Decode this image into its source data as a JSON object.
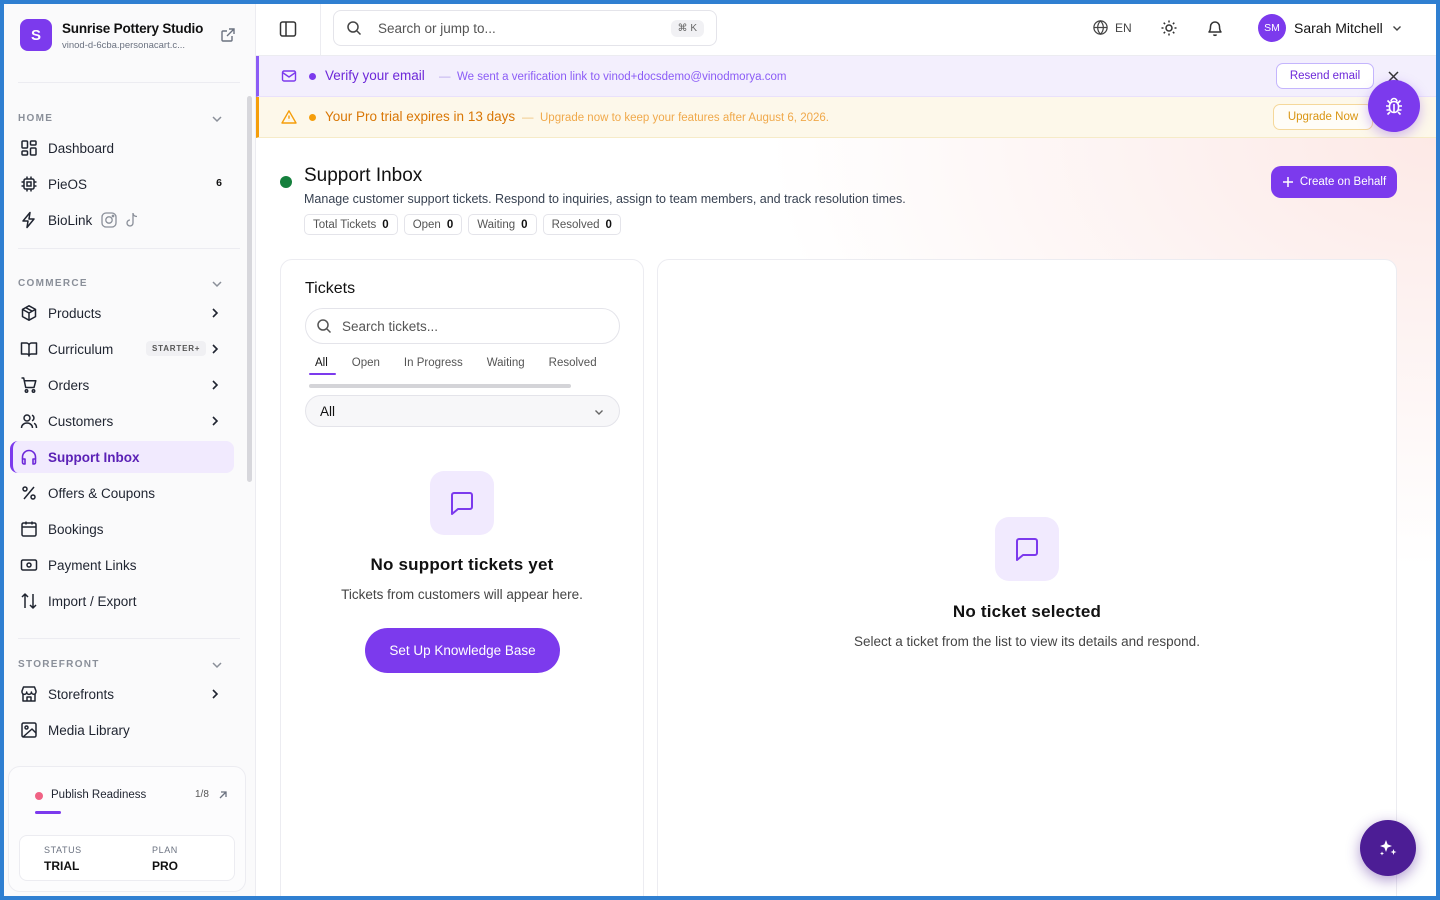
{
  "brand": {
    "initial": "S",
    "name": "Sunrise Pottery Studio",
    "subdomain": "vinod-d-6cba.personacart.c..."
  },
  "sidebar": {
    "sections": {
      "home": "HOME",
      "commerce": "COMMERCE",
      "storefront": "STOREFRONT"
    },
    "items": {
      "dashboard": "Dashboard",
      "pieos": "PieOS",
      "pieos_count": "6",
      "biolink": "BioLink",
      "products": "Products",
      "curriculum": "Curriculum",
      "curriculum_badge": "STARTER+",
      "orders": "Orders",
      "customers": "Customers",
      "support_inbox": "Support Inbox",
      "offers": "Offers & Coupons",
      "bookings": "Bookings",
      "payment_links": "Payment Links",
      "import_export": "Import / Export",
      "storefronts": "Storefronts",
      "media_library": "Media Library"
    },
    "readiness": {
      "title": "Publish Readiness",
      "count": "1/8",
      "progress_fraction": 0.125,
      "status_label": "STATUS",
      "status_value": "TRIAL",
      "plan_label": "PLAN",
      "plan_value": "PRO"
    }
  },
  "topbar": {
    "search_placeholder": "Search or jump to...",
    "shortcut": "⌘ K",
    "language": "EN",
    "user_initials": "SM",
    "user_name": "Sarah Mitchell"
  },
  "banners": {
    "verify": {
      "title": "Verify your email",
      "separator": "—",
      "desc": "We sent a verification link to vinod+docsdemo@vinodmorya.com",
      "button": "Resend email"
    },
    "trial": {
      "title": "Your Pro trial expires in 13 days",
      "separator": "—",
      "desc": "Upgrade now to keep your features after August 6, 2026.",
      "button": "Upgrade Now"
    }
  },
  "page": {
    "title": "Support Inbox",
    "desc": "Manage customer support tickets. Respond to inquiries, assign to team members, and track resolution times.",
    "create_button": "Create on Behalf",
    "stats": [
      {
        "label": "Total Tickets",
        "value": "0"
      },
      {
        "label": "Open",
        "value": "0"
      },
      {
        "label": "Waiting",
        "value": "0"
      },
      {
        "label": "Resolved",
        "value": "0"
      }
    ]
  },
  "tickets": {
    "title": "Tickets",
    "search_placeholder": "Search tickets...",
    "tabs": [
      "All",
      "Open",
      "In Progress",
      "Waiting",
      "Resolved"
    ],
    "filter_value": "All",
    "empty_title": "No support tickets yet",
    "empty_desc": "Tickets from customers will appear here.",
    "kb_button": "Set Up Knowledge Base"
  },
  "detail": {
    "empty_title": "No ticket selected",
    "empty_desc": "Select a ticket from the list to view its details and respond."
  },
  "colors": {
    "accent": "#7c3aed",
    "success": "#15803d",
    "warning": "#f59e0b"
  }
}
